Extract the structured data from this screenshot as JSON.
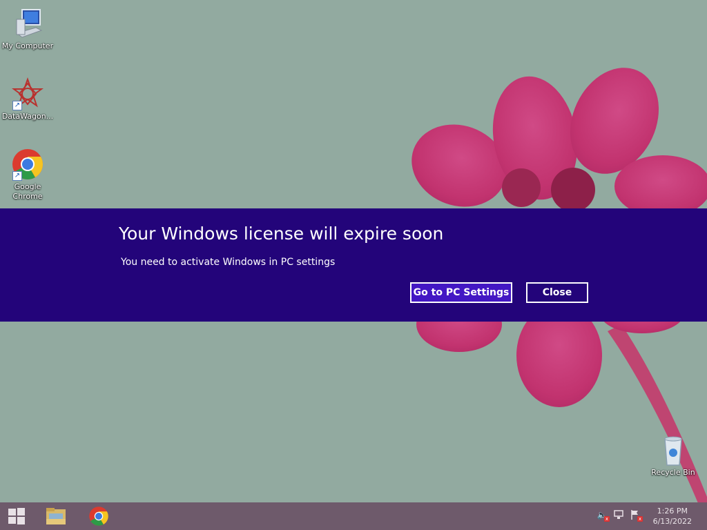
{
  "desktop": {
    "icons": [
      {
        "label": "My Computer"
      },
      {
        "label": "DataWagon..."
      },
      {
        "label": "Google Chrome"
      },
      {
        "label": "Recycle Bin"
      }
    ]
  },
  "banner": {
    "title": "Your Windows license will expire soon",
    "message": "You need to activate Windows in PC settings",
    "primary_button": "Go to PC Settings",
    "secondary_button": "Close",
    "background_color": "#23047a",
    "accent_color": "#4317c4"
  },
  "taskbar": {
    "items": [
      {
        "icon": "windows-start-icon"
      },
      {
        "icon": "file-explorer-icon"
      },
      {
        "icon": "chrome-icon"
      }
    ],
    "tray": [
      {
        "icon": "volume-muted-icon"
      },
      {
        "icon": "network-icon"
      },
      {
        "icon": "action-center-flag-icon"
      }
    ],
    "time": "1:26 PM",
    "date": "6/13/2022"
  }
}
